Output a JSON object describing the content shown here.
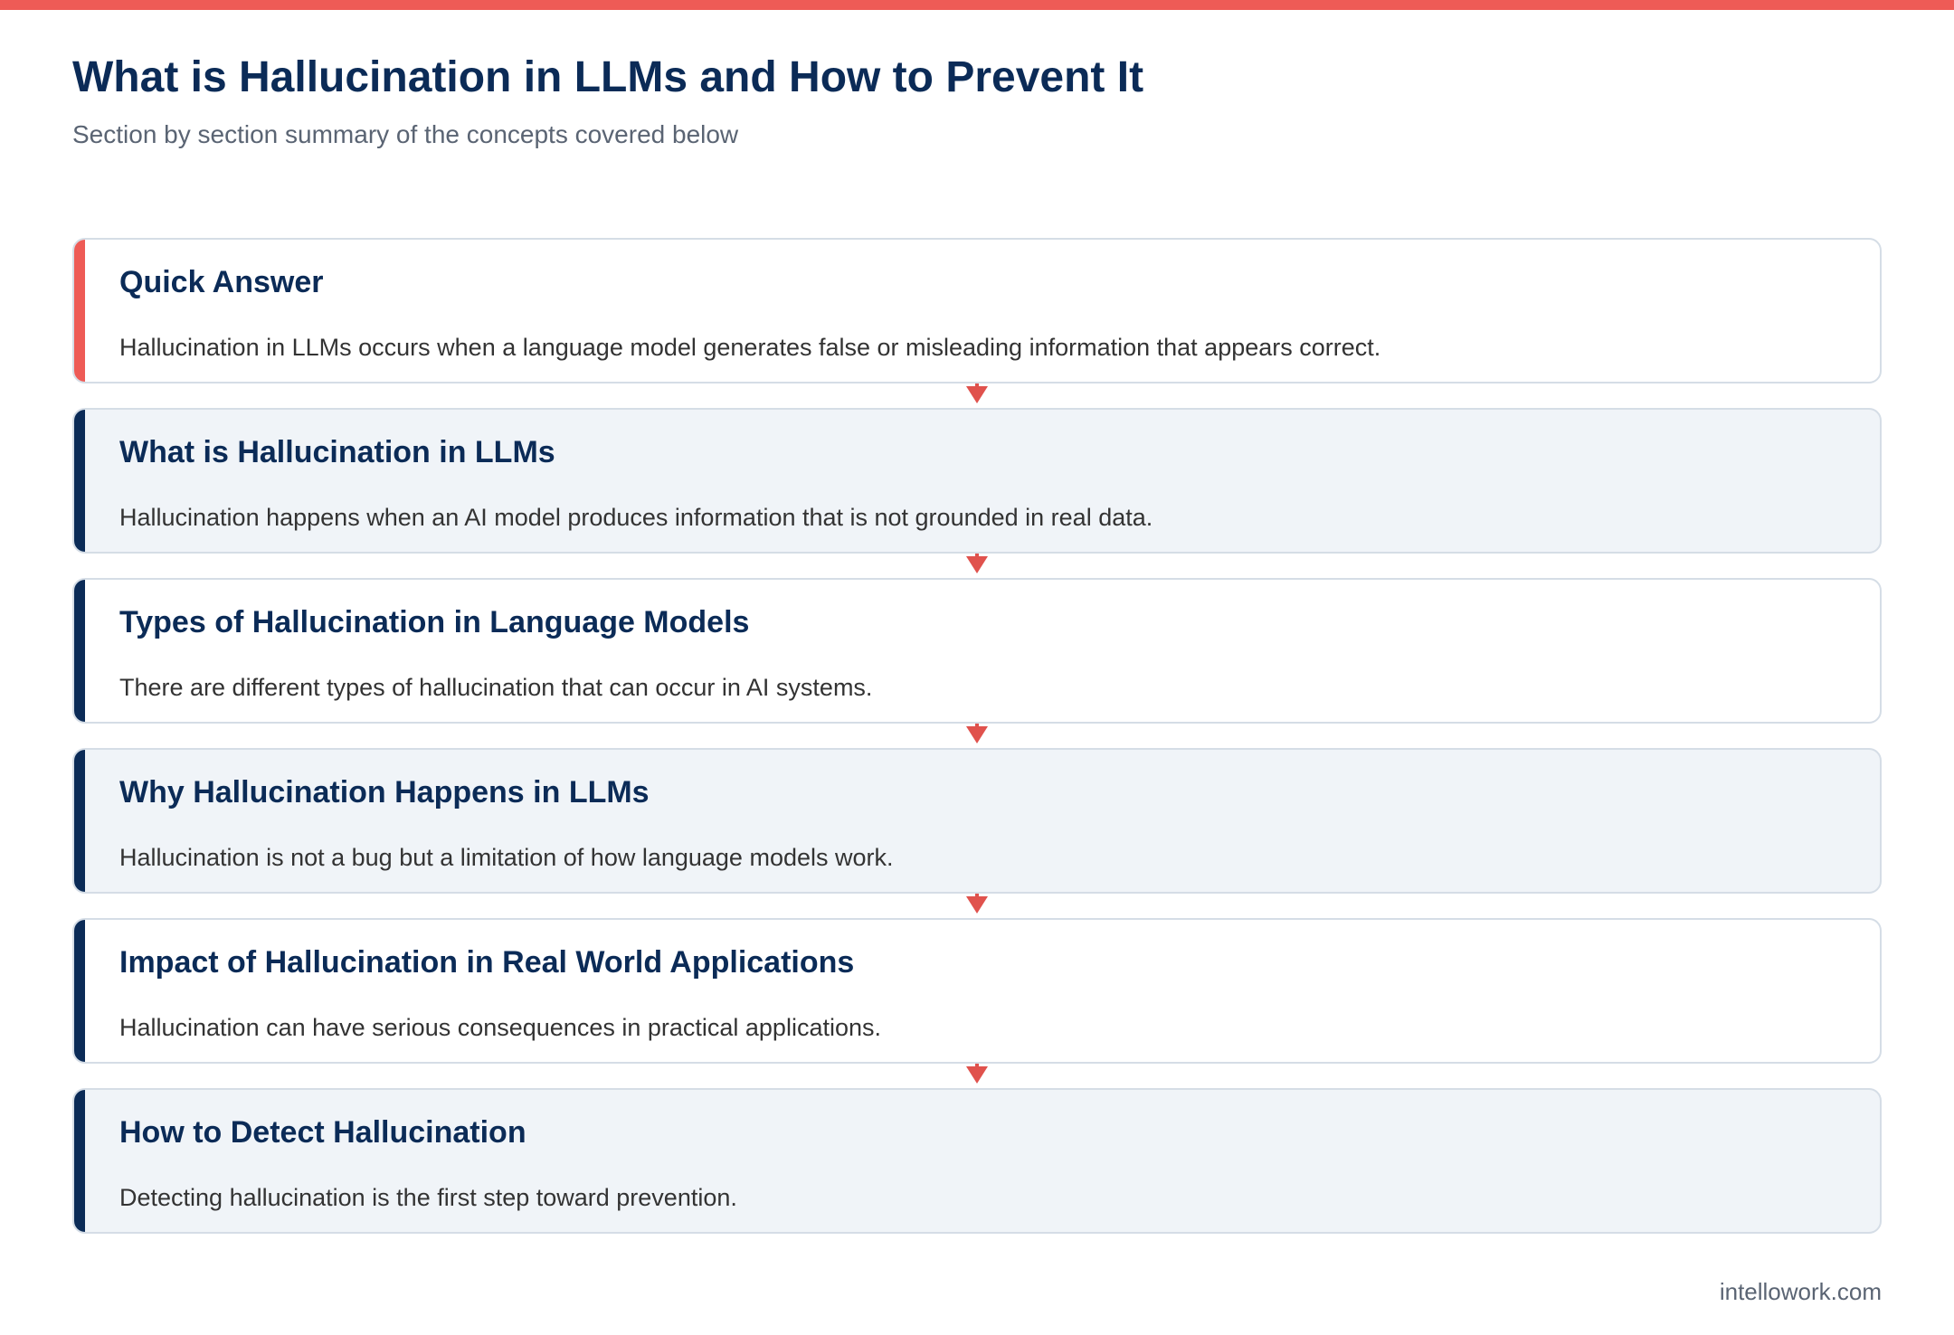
{
  "header": {
    "title": "What is Hallucination in LLMs and How to Prevent It",
    "subtitle": "Section by section summary of the concepts covered below"
  },
  "sections": [
    {
      "heading": "Quick Answer",
      "text": "Hallucination in LLMs occurs when a language model generates false or misleading information that appears correct."
    },
    {
      "heading": "What is Hallucination in LLMs",
      "text": "Hallucination happens when an AI model produces information that is not grounded in real data."
    },
    {
      "heading": "Types of Hallucination in Language Models",
      "text": "There are different types of hallucination that can occur in AI systems."
    },
    {
      "heading": "Why Hallucination Happens in LLMs",
      "text": "Hallucination is not a bug but a limitation of how language models work."
    },
    {
      "heading": "Impact of Hallucination in Real World Applications",
      "text": "Hallucination can have serious consequences in practical applications."
    },
    {
      "heading": "How to Detect Hallucination",
      "text": "Detecting hallucination is the first step toward prevention."
    }
  ],
  "footer": {
    "credit": "intellowork.com"
  },
  "colors": {
    "accent_red": "#ee5b56",
    "navy": "#0b2b57",
    "card_alt_bg": "#f0f4f8",
    "border": "#d5dde6"
  }
}
